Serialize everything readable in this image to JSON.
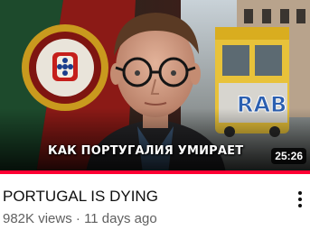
{
  "thumbnail": {
    "caption": "КАК ПОРТУГАЛИЯ УМИРАЕТ",
    "duration": "25:26",
    "tram_graffiti": "RAB",
    "watch_progress_fraction": 1.0
  },
  "video": {
    "title": "PORTUGAL IS DYING",
    "views": "982K views",
    "separator": "·",
    "age": "11 days ago"
  },
  "more_menu": {
    "icon": "more-vertical-icon"
  },
  "colors": {
    "progress": "#ff0033",
    "title": "#0f0f0f",
    "meta": "#606060"
  }
}
